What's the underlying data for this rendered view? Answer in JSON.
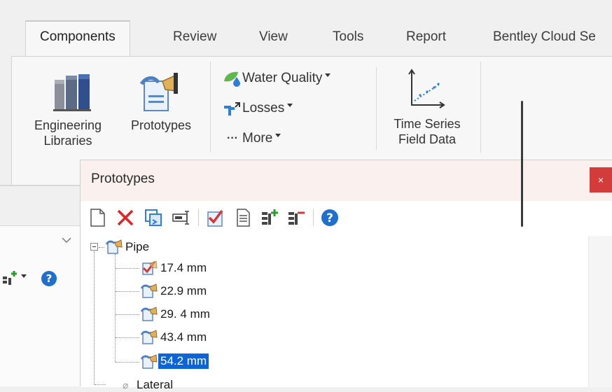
{
  "ribbon": {
    "tabs": [
      {
        "label": "Components",
        "active": true
      },
      {
        "label": "Review"
      },
      {
        "label": "View"
      },
      {
        "label": "Tools"
      },
      {
        "label": "Report"
      },
      {
        "label": "Bentley Cloud Se"
      }
    ],
    "buttons": {
      "engineering_libraries": {
        "line1": "Engineering",
        "line2": "Libraries",
        "icon": "books-icon"
      },
      "prototypes": {
        "label": "Prototypes",
        "icon": "prototype-icon"
      },
      "water_quality": {
        "label": "Water Quality",
        "icon": "leaf-drop-icon"
      },
      "losses": {
        "label": "Losses",
        "icon": "losses-icon"
      },
      "more": {
        "label": "More",
        "icon": "ellipsis-icon"
      },
      "time_series": {
        "line1": "Time Series",
        "line2": "Field Data",
        "icon": "chart-icon"
      }
    }
  },
  "panel": {
    "title": "Prototypes",
    "close_label": "×",
    "toolbar": [
      {
        "name": "new-icon"
      },
      {
        "name": "delete-icon"
      },
      {
        "name": "duplicate-icon"
      },
      {
        "name": "rename-icon"
      },
      {
        "name": "make-default-icon"
      },
      {
        "name": "report-icon"
      },
      {
        "name": "expand-all-icon"
      },
      {
        "name": "collapse-all-icon"
      },
      {
        "name": "help-icon"
      }
    ],
    "tree": {
      "root": {
        "label": "Pipe",
        "expander": "⊟"
      },
      "children": [
        {
          "label": "17.4 mm",
          "default": true
        },
        {
          "label": "22.9 mm"
        },
        {
          "label": "29. 4 mm"
        },
        {
          "label": "43.4 mm"
        },
        {
          "label": "54.2 mm",
          "selected": true
        }
      ],
      "next_root": {
        "label": "Lateral",
        "icon": "none-icon"
      }
    }
  },
  "colors": {
    "accent": "#0a66d8",
    "close": "#d43c3c",
    "help": "#1f6fcf",
    "delete": "#e02424"
  }
}
